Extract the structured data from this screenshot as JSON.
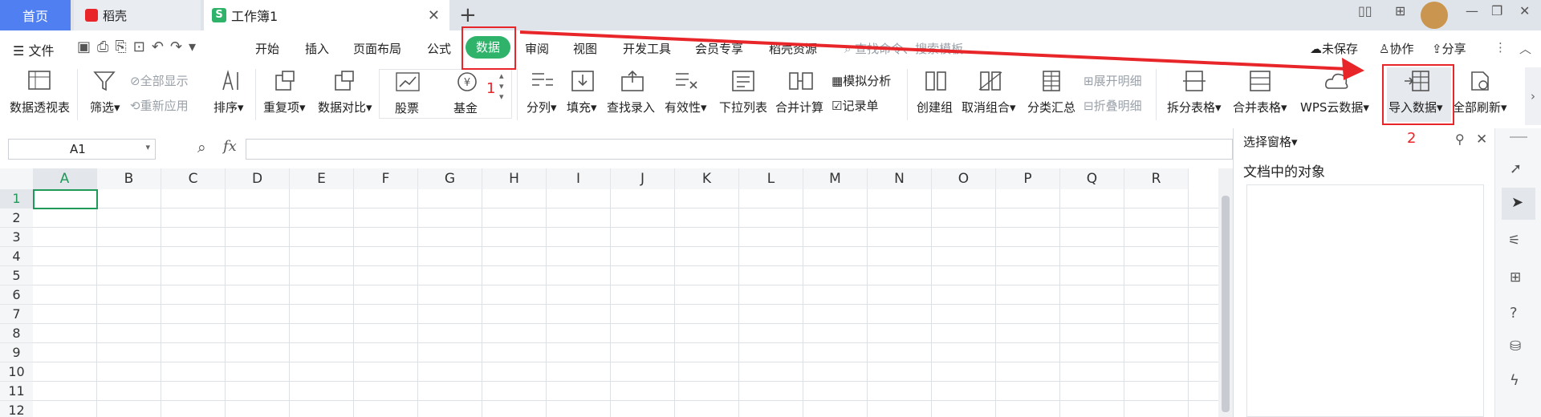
{
  "tabs": {
    "home": "首页",
    "daoke": "稻壳",
    "workbook": "工作簿1",
    "workbook_badge": "S"
  },
  "menu": {
    "file": "文件",
    "items": [
      "开始",
      "插入",
      "页面布局",
      "公式",
      "数据",
      "审阅",
      "视图",
      "开发工具",
      "会员专享",
      "稻壳资源"
    ],
    "active": "数据",
    "search": "查找命令、搜索模板",
    "unsaved": "未保存",
    "collab": "协作",
    "share": "分享"
  },
  "ribbon": {
    "pivot": "数据透视表",
    "filter": "筛选",
    "show_all": "全部显示",
    "reapply": "重新应用",
    "sort": "排序",
    "duplicates": "重复项",
    "compare": "数据对比",
    "stock": "股票",
    "fund": "基金",
    "split": "分列",
    "fill": "填充",
    "lookup": "查找录入",
    "validity": "有效性",
    "dropdown": "下拉列表",
    "consolidate": "合并计算",
    "simulate": "模拟分析",
    "record": "记录单",
    "create_group": "创建组",
    "ungroup": "取消组合",
    "subtotal": "分类汇总",
    "expand": "展开明细",
    "collapse": "折叠明细",
    "split_table": "拆分表格",
    "merge_table": "合并表格",
    "wps_cloud": "WPS云数据",
    "import": "导入数据",
    "refresh_all": "全部刷新"
  },
  "formula": {
    "cell_ref": "A1",
    "fx": "fx"
  },
  "grid": {
    "columns": [
      "A",
      "B",
      "C",
      "D",
      "E",
      "F",
      "G",
      "H",
      "I",
      "J",
      "K",
      "L",
      "M",
      "N",
      "O",
      "P",
      "Q",
      "R"
    ],
    "rows": [
      "1",
      "2",
      "3",
      "4",
      "5",
      "6",
      "7",
      "8",
      "9",
      "10",
      "11",
      "12"
    ]
  },
  "panel": {
    "title": "选择窗格",
    "subtitle": "文档中的对象"
  },
  "annotations": {
    "step1": "1",
    "step2": "2"
  },
  "colors": {
    "accent": "#2fb36b",
    "home_tab": "#4f7ff0",
    "annotation": "#e8262a"
  }
}
